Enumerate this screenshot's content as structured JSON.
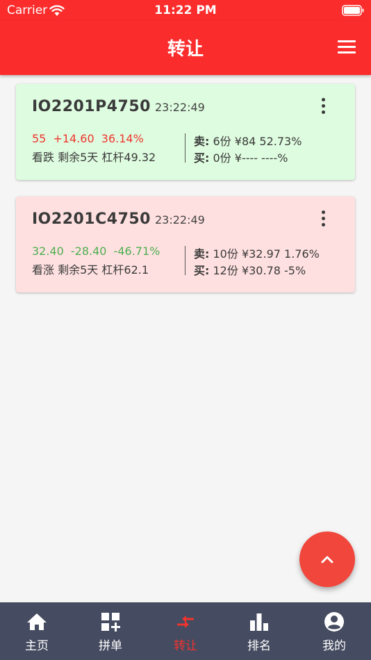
{
  "status_bar": {
    "carrier": "Carrier",
    "time": "11:22 PM"
  },
  "app_bar": {
    "title": "转让",
    "menu_icon": "hamburger-menu-icon"
  },
  "colors": {
    "primary_red": "#fb2c2c",
    "up_red": "#f0342f",
    "down_green": "#4caf50",
    "card_green_bg": "#defcdf",
    "card_pink_bg": "#ffe0e0",
    "nav_bg": "#454b60"
  },
  "cards": [
    {
      "code": "IO2201P4750",
      "time": "23:22:49",
      "price": "55",
      "change": "+14.60",
      "change_pct": "36.14%",
      "direction": "看跌",
      "remaining": "剩余5天",
      "leverage": "杠杆49.32",
      "sell_label": "卖:",
      "sell_text": "6份  ¥84 52.73%",
      "buy_label": "买:",
      "buy_text": "0份  ¥---- ----%"
    },
    {
      "code": "IO2201C4750",
      "time": "23:22:49",
      "price": "32.40",
      "change": "-28.40",
      "change_pct": "-46.71%",
      "direction": "看涨",
      "remaining": "剩余5天",
      "leverage": "杠杆62.1",
      "sell_label": "卖:",
      "sell_text": "10份  ¥32.97 1.76%",
      "buy_label": "买:",
      "buy_text": "12份  ¥30.78 -5%"
    }
  ],
  "fab": {
    "icon": "chevron-up-icon"
  },
  "bottom_nav": {
    "items": [
      {
        "label": "主页",
        "icon": "home-icon"
      },
      {
        "label": "拼单",
        "icon": "grid-add-icon"
      },
      {
        "label": "转让",
        "icon": "transfer-arrows-icon",
        "active": true
      },
      {
        "label": "排名",
        "icon": "bar-chart-icon"
      },
      {
        "label": "我的",
        "icon": "account-circle-icon"
      }
    ]
  }
}
